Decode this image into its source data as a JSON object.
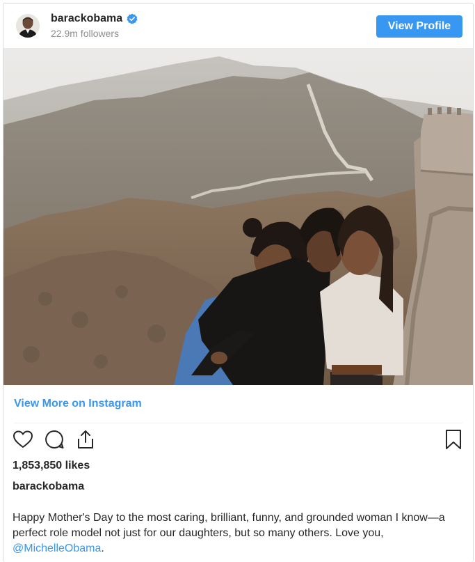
{
  "header": {
    "username": "barackobama",
    "followers": "22.9m followers",
    "view_profile_label": "View Profile"
  },
  "post": {
    "view_more_label": "View More on Instagram",
    "likes": "1,853,850 likes",
    "author": "barackobama",
    "caption_text": "Happy Mother's Day to the most caring, brilliant, funny, and grounded woman I know—a perfect role model not just for our daughters, but so many others. Love you, ",
    "caption_mention": "@MichelleObama",
    "caption_end": "."
  },
  "icons": {
    "like": "heart-outline-icon",
    "comment": "comment-bubble-icon",
    "share": "share-upload-icon",
    "save": "bookmark-icon",
    "verified": "verified-badge-icon"
  },
  "colors": {
    "accent": "#3897f0",
    "text": "#262626",
    "muted": "#8e8e8e",
    "border": "#dbdbdb"
  }
}
